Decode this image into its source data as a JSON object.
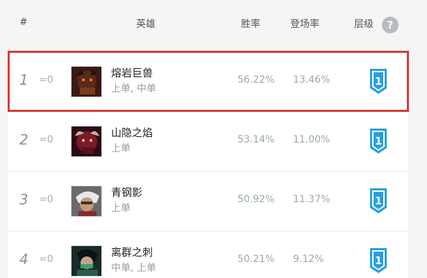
{
  "header": {
    "rank_col": "#",
    "hero_col": "英雄",
    "winrate_col": "胜率",
    "pickrate_col": "登场率",
    "tier_col": "层级",
    "help_symbol": "?"
  },
  "colors": {
    "highlight_border": "#d93a36",
    "tier_badge": "#27a0e0",
    "background": "#f4f5f7"
  },
  "rows": [
    {
      "rank": "1",
      "change": "=0",
      "name": "熔岩巨兽",
      "positions": "上单, 中单",
      "win_rate": "56.22%",
      "pick_rate": "13.46%",
      "tier": "1",
      "avatar_icon": "malphite-portrait-icon",
      "highlighted": true
    },
    {
      "rank": "2",
      "change": "=0",
      "name": "山隐之焰",
      "positions": "上单",
      "win_rate": "53.14%",
      "pick_rate": "11.00%",
      "tier": "1",
      "avatar_icon": "ornn-portrait-icon",
      "highlighted": false
    },
    {
      "rank": "3",
      "change": "=0",
      "name": "青钢影",
      "positions": "上单",
      "win_rate": "50.92%",
      "pick_rate": "11.37%",
      "tier": "1",
      "avatar_icon": "camille-portrait-icon",
      "highlighted": false
    },
    {
      "rank": "4",
      "change": "=0",
      "name": "离群之刺",
      "positions": "中单, 上单",
      "win_rate": "50.21%",
      "pick_rate": "9.12%",
      "tier": "1",
      "avatar_icon": "akali-portrait-icon",
      "highlighted": false
    }
  ]
}
